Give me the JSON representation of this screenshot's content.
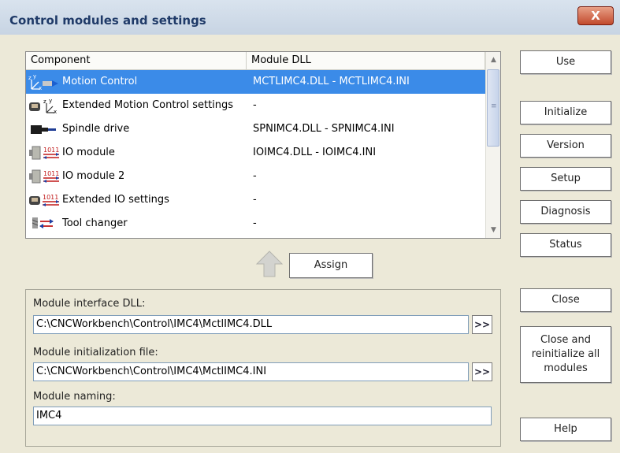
{
  "window": {
    "title": "Control modules and settings",
    "close_glyph": "X"
  },
  "list": {
    "columns": [
      "Component",
      "Module DLL"
    ],
    "rows": [
      {
        "icon": "motion-axes-icon",
        "label": "Motion Control",
        "dll": "MCTLIMC4.DLL - MCTLIMC4.INI",
        "selected": true
      },
      {
        "icon": "extended-motion-settings-icon",
        "label": "Extended Motion Control settings",
        "dll": "-",
        "selected": false
      },
      {
        "icon": "spindle-drive-icon",
        "label": "Spindle drive",
        "dll": "SPNIMC4.DLL - SPNIMC4.INI",
        "selected": false
      },
      {
        "icon": "io-module-icon",
        "label": "IO module",
        "dll": "IOIMC4.DLL - IOIMC4.INI",
        "selected": false
      },
      {
        "icon": "io-module-2-icon",
        "label": "IO module 2",
        "dll": "-",
        "selected": false
      },
      {
        "icon": "extended-io-settings-icon",
        "label": "Extended IO settings",
        "dll": "-",
        "selected": false
      },
      {
        "icon": "tool-changer-icon",
        "label": "Tool changer",
        "dll": "-",
        "selected": false
      }
    ]
  },
  "assign": {
    "label": "Assign"
  },
  "module": {
    "interface_label": "Module interface DLL:",
    "interface_value": "C:\\CNCWorkbench\\Control\\IMC4\\MctlIMC4.DLL",
    "init_label": "Module initialization file:",
    "init_value": "C:\\CNCWorkbench\\Control\\IMC4\\MctlIMC4.INI",
    "naming_label": "Module naming:",
    "naming_value": "IMC4",
    "browse_label": ">>"
  },
  "buttons": {
    "use": "Use",
    "initialize": "Initialize",
    "version": "Version",
    "setup": "Setup",
    "diagnosis": "Diagnosis",
    "status": "Status",
    "close": "Close",
    "close_reinit": [
      "Close and",
      "reinitialize all",
      "modules"
    ],
    "help": "Help"
  }
}
